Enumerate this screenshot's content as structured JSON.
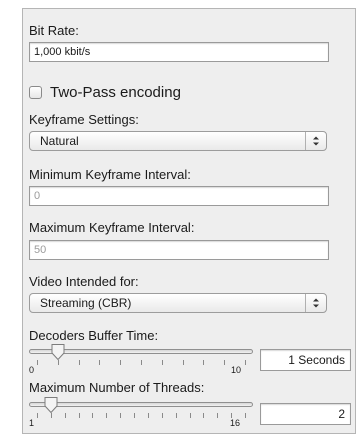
{
  "bit_rate": {
    "label": "Bit Rate:",
    "value": "1,000 kbit/s"
  },
  "two_pass": {
    "label": "Two-Pass encoding",
    "checked": false
  },
  "keyframe_settings": {
    "label": "Keyframe Settings:",
    "selected": "Natural"
  },
  "min_keyframe": {
    "label": "Minimum Keyframe Interval:",
    "value": "0",
    "enabled": false
  },
  "max_keyframe": {
    "label": "Maximum Keyframe Interval:",
    "value": "50",
    "enabled": false
  },
  "video_intended": {
    "label": "Video Intended for:",
    "selected": "Streaming (CBR)"
  },
  "decoder_buffer": {
    "label": "Decoders Buffer Time:",
    "min_label": "0",
    "max_label": "10",
    "min": 0,
    "max": 10,
    "value": 1,
    "ticks": 11,
    "display": "1 Seconds"
  },
  "max_threads": {
    "label": "Maximum Number of Threads:",
    "min_label": "1",
    "max_label": "16",
    "min": 1,
    "max": 16,
    "value": 2,
    "ticks": 16,
    "display": "2"
  }
}
